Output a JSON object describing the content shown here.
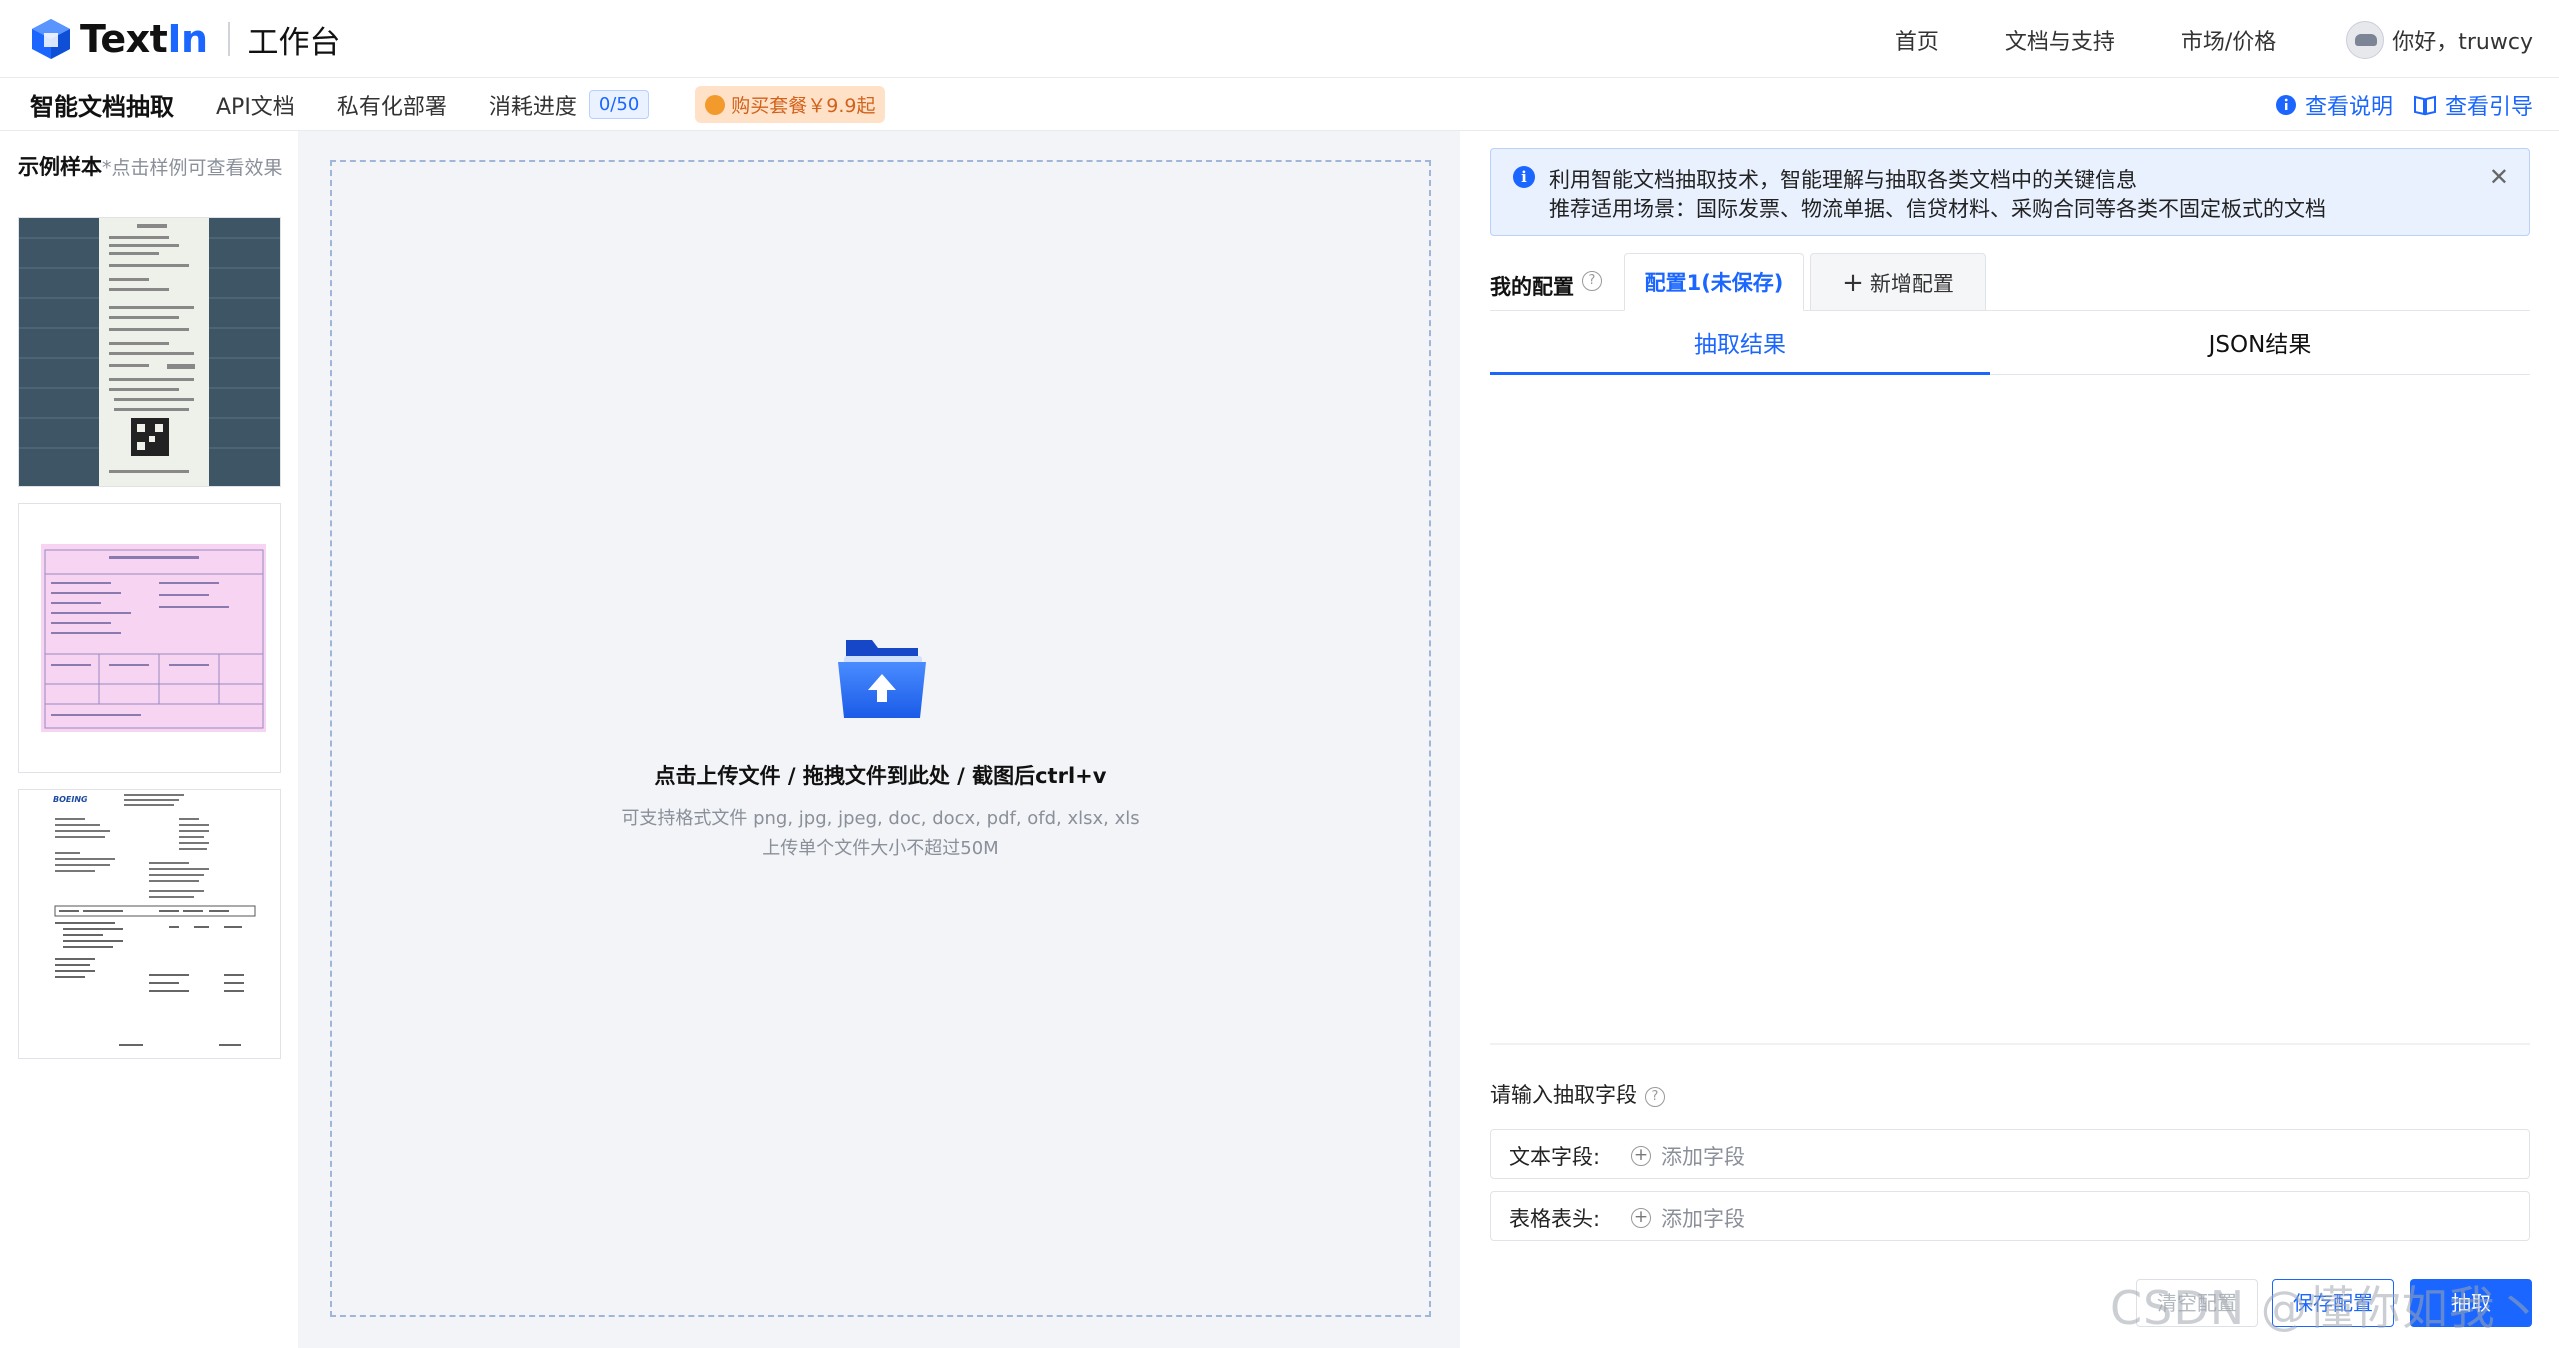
{
  "header": {
    "brand_text": "Text",
    "brand_in": "In",
    "workspace": "工作台",
    "nav": [
      "首页",
      "文档与支持",
      "市场/价格"
    ],
    "greeting": "你好，truwcy"
  },
  "subbar": {
    "active": "智能文档抽取",
    "items": [
      "API文档",
      "私有化部署",
      "消耗进度"
    ],
    "quota": "0/50",
    "promo": "购买套餐￥9.9起",
    "links": [
      "查看说明",
      "查看引导"
    ]
  },
  "samples": {
    "title": "示例样本",
    "hint": "*点击样例可查看效果"
  },
  "upload": {
    "main": "点击上传文件 / 拖拽文件到此处 / 截图后ctrl+v",
    "formats": "可支持格式文件 png, jpg, jpeg, doc, docx, pdf, ofd, xlsx, xls",
    "size_limit": "上传单个文件大小不超过50M"
  },
  "info": {
    "line1": "利用智能文档抽取技术，智能理解与抽取各类文档中的关键信息",
    "line2": "推荐适用场景：国际发票、物流单据、信贷材料、采购合同等各类不固定板式的文档"
  },
  "config": {
    "label": "我的配置",
    "tab_active": "配置1(未保存)",
    "tab_new": "新增配置"
  },
  "result_tabs": [
    "抽取结果",
    "JSON结果"
  ],
  "fields": {
    "title": "请输入抽取字段",
    "rows": [
      {
        "label": "文本字段:",
        "add": "添加字段"
      },
      {
        "label": "表格表头:",
        "add": "添加字段"
      }
    ]
  },
  "buttons": {
    "clear": "清空配置",
    "save": "保存配置",
    "extract": "抽取"
  },
  "watermark": "CSDN @懂你如我丶",
  "colors": {
    "accent": "#1a66ff",
    "promo_bg": "#ffe1c8",
    "info_bg": "#e9f1ff",
    "upload_bg": "#f2f4f7"
  }
}
